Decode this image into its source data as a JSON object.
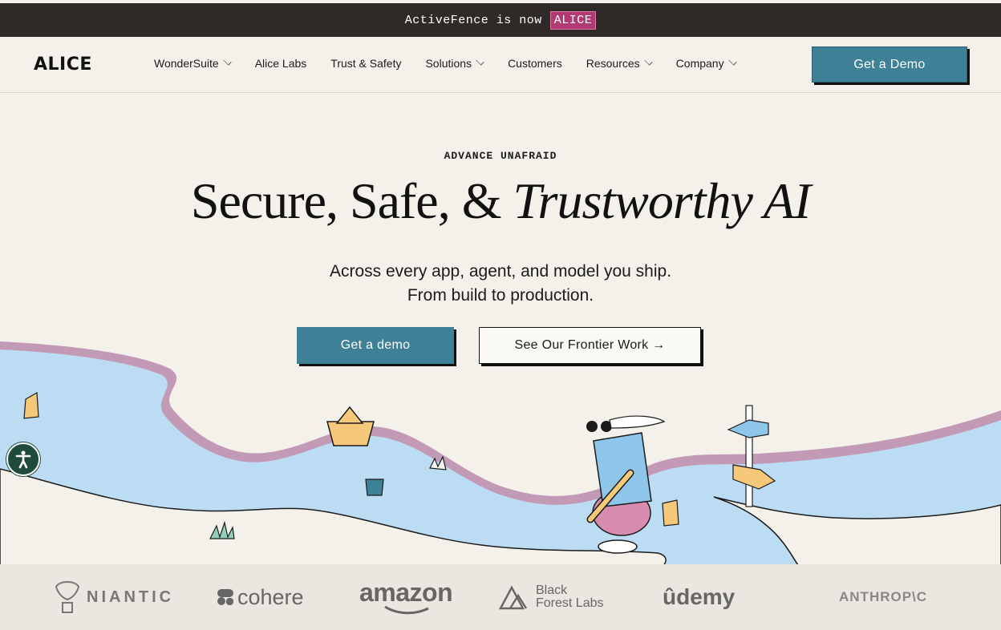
{
  "banner": {
    "text": "ActiveFence is now",
    "badge": "ALICE"
  },
  "nav": {
    "logo": "ALICE",
    "items": [
      {
        "label": "WonderSuite",
        "dropdown": true
      },
      {
        "label": "Alice Labs",
        "dropdown": false
      },
      {
        "label": "Trust & Safety",
        "dropdown": false
      },
      {
        "label": "Solutions",
        "dropdown": true
      },
      {
        "label": "Customers",
        "dropdown": false
      },
      {
        "label": "Resources",
        "dropdown": true
      },
      {
        "label": "Company",
        "dropdown": true
      }
    ],
    "cta": "Get a Demo"
  },
  "hero": {
    "eyebrow": "ADVANCE UNAFRAID",
    "headline_plain": "Secure, Safe, &",
    "headline_italic": "Trustworthy AI",
    "sub_line1": "Across every app, agent, and model you ship.",
    "sub_line2": "From build to production.",
    "primary_cta": "Get a demo",
    "secondary_cta": "See Our Frontier Work →"
  },
  "logos": {
    "niantic": "NIANTIC",
    "cohere": "cohere",
    "amazon": "amazon",
    "bfl": "Black\nForest Labs",
    "udemy": "ûdemy",
    "anthropic": "ANTHROP\\C"
  },
  "colors": {
    "banner_bg": "#2f2a28",
    "badge": "#b23a73",
    "accent": "#3e8196",
    "page_bg": "#f4f0ea",
    "river": "#bcdcf3",
    "riverbank": "#c39ab6"
  },
  "icons": {
    "accessibility": "accessibility-icon",
    "chevron": "chevron-down-icon"
  }
}
